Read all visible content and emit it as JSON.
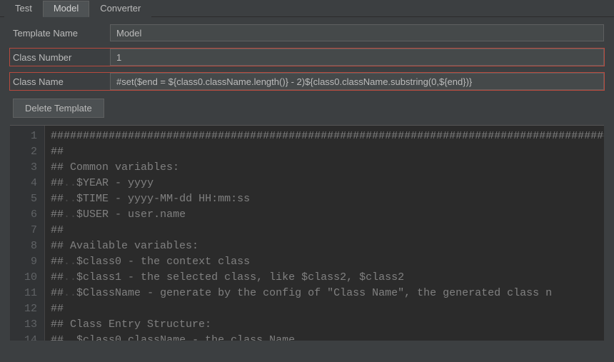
{
  "tabs": [
    {
      "label": "Test",
      "active": false
    },
    {
      "label": "Model",
      "active": true
    },
    {
      "label": "Converter",
      "active": false
    }
  ],
  "form": {
    "template_name_label": "Template Name",
    "template_name_value": "Model",
    "class_number_label": "Class Number",
    "class_number_value": "1",
    "class_name_label": "Class Name",
    "class_name_value": "#set($end = ${class0.className.length()} - 2)${class0.className.substring(0,${end})}"
  },
  "buttons": {
    "delete_template": "Delete Template"
  },
  "editor": {
    "lines": [
      "########################################################################################",
      "##",
      "## Common variables:",
      "##  $YEAR - yyyy",
      "##  $TIME - yyyy-MM-dd HH:mm:ss",
      "##  $USER - user.name",
      "##",
      "## Available variables:",
      "##  $class0 - the context class",
      "##  $class1 - the selected class, like $class2, $class2",
      "##  $ClassName - generate by the config of \"Class Name\", the generated class n",
      "##",
      "## Class Entry Structure:",
      "##  $class0.className - the class Name"
    ]
  }
}
